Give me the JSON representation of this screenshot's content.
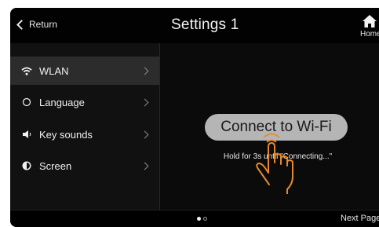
{
  "header": {
    "back_label": "Return",
    "title": "Settings 1",
    "home_label": "Home"
  },
  "sidebar": {
    "items": [
      {
        "label": "WLAN",
        "icon": "wifi-icon",
        "active": true
      },
      {
        "label": "Language",
        "icon": "circle-icon",
        "active": false
      },
      {
        "label": "Key sounds",
        "icon": "speaker-icon",
        "active": false
      },
      {
        "label": "Screen",
        "icon": "brightness-icon",
        "active": false
      }
    ]
  },
  "main": {
    "connect_button_label": "Connect to Wi-Fi",
    "hint_text": "Hold for 3s until \"Connecting...\""
  },
  "footer": {
    "page_indicator": {
      "current": 1,
      "total": 2
    },
    "next_label": "Next Page"
  },
  "colors": {
    "screen_bg": "#0b0b0b",
    "active_item_bg": "#2c2c2c",
    "button_bg": "#b5b5b5",
    "hand_outline": "#e58a2a"
  }
}
